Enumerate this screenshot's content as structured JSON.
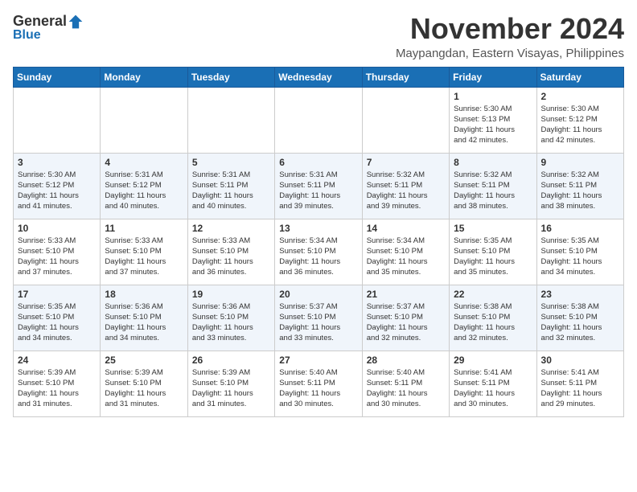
{
  "header": {
    "logo": {
      "general": "General",
      "blue": "Blue"
    },
    "title": "November 2024",
    "location": "Maypangdan, Eastern Visayas, Philippines"
  },
  "weekdays": [
    "Sunday",
    "Monday",
    "Tuesday",
    "Wednesday",
    "Thursday",
    "Friday",
    "Saturday"
  ],
  "weeks": [
    [
      {
        "day": "",
        "info": ""
      },
      {
        "day": "",
        "info": ""
      },
      {
        "day": "",
        "info": ""
      },
      {
        "day": "",
        "info": ""
      },
      {
        "day": "",
        "info": ""
      },
      {
        "day": "1",
        "info": "Sunrise: 5:30 AM\nSunset: 5:13 PM\nDaylight: 11 hours\nand 42 minutes."
      },
      {
        "day": "2",
        "info": "Sunrise: 5:30 AM\nSunset: 5:12 PM\nDaylight: 11 hours\nand 42 minutes."
      }
    ],
    [
      {
        "day": "3",
        "info": "Sunrise: 5:30 AM\nSunset: 5:12 PM\nDaylight: 11 hours\nand 41 minutes."
      },
      {
        "day": "4",
        "info": "Sunrise: 5:31 AM\nSunset: 5:12 PM\nDaylight: 11 hours\nand 40 minutes."
      },
      {
        "day": "5",
        "info": "Sunrise: 5:31 AM\nSunset: 5:11 PM\nDaylight: 11 hours\nand 40 minutes."
      },
      {
        "day": "6",
        "info": "Sunrise: 5:31 AM\nSunset: 5:11 PM\nDaylight: 11 hours\nand 39 minutes."
      },
      {
        "day": "7",
        "info": "Sunrise: 5:32 AM\nSunset: 5:11 PM\nDaylight: 11 hours\nand 39 minutes."
      },
      {
        "day": "8",
        "info": "Sunrise: 5:32 AM\nSunset: 5:11 PM\nDaylight: 11 hours\nand 38 minutes."
      },
      {
        "day": "9",
        "info": "Sunrise: 5:32 AM\nSunset: 5:11 PM\nDaylight: 11 hours\nand 38 minutes."
      }
    ],
    [
      {
        "day": "10",
        "info": "Sunrise: 5:33 AM\nSunset: 5:10 PM\nDaylight: 11 hours\nand 37 minutes."
      },
      {
        "day": "11",
        "info": "Sunrise: 5:33 AM\nSunset: 5:10 PM\nDaylight: 11 hours\nand 37 minutes."
      },
      {
        "day": "12",
        "info": "Sunrise: 5:33 AM\nSunset: 5:10 PM\nDaylight: 11 hours\nand 36 minutes."
      },
      {
        "day": "13",
        "info": "Sunrise: 5:34 AM\nSunset: 5:10 PM\nDaylight: 11 hours\nand 36 minutes."
      },
      {
        "day": "14",
        "info": "Sunrise: 5:34 AM\nSunset: 5:10 PM\nDaylight: 11 hours\nand 35 minutes."
      },
      {
        "day": "15",
        "info": "Sunrise: 5:35 AM\nSunset: 5:10 PM\nDaylight: 11 hours\nand 35 minutes."
      },
      {
        "day": "16",
        "info": "Sunrise: 5:35 AM\nSunset: 5:10 PM\nDaylight: 11 hours\nand 34 minutes."
      }
    ],
    [
      {
        "day": "17",
        "info": "Sunrise: 5:35 AM\nSunset: 5:10 PM\nDaylight: 11 hours\nand 34 minutes."
      },
      {
        "day": "18",
        "info": "Sunrise: 5:36 AM\nSunset: 5:10 PM\nDaylight: 11 hours\nand 34 minutes."
      },
      {
        "day": "19",
        "info": "Sunrise: 5:36 AM\nSunset: 5:10 PM\nDaylight: 11 hours\nand 33 minutes."
      },
      {
        "day": "20",
        "info": "Sunrise: 5:37 AM\nSunset: 5:10 PM\nDaylight: 11 hours\nand 33 minutes."
      },
      {
        "day": "21",
        "info": "Sunrise: 5:37 AM\nSunset: 5:10 PM\nDaylight: 11 hours\nand 32 minutes."
      },
      {
        "day": "22",
        "info": "Sunrise: 5:38 AM\nSunset: 5:10 PM\nDaylight: 11 hours\nand 32 minutes."
      },
      {
        "day": "23",
        "info": "Sunrise: 5:38 AM\nSunset: 5:10 PM\nDaylight: 11 hours\nand 32 minutes."
      }
    ],
    [
      {
        "day": "24",
        "info": "Sunrise: 5:39 AM\nSunset: 5:10 PM\nDaylight: 11 hours\nand 31 minutes."
      },
      {
        "day": "25",
        "info": "Sunrise: 5:39 AM\nSunset: 5:10 PM\nDaylight: 11 hours\nand 31 minutes."
      },
      {
        "day": "26",
        "info": "Sunrise: 5:39 AM\nSunset: 5:10 PM\nDaylight: 11 hours\nand 31 minutes."
      },
      {
        "day": "27",
        "info": "Sunrise: 5:40 AM\nSunset: 5:11 PM\nDaylight: 11 hours\nand 30 minutes."
      },
      {
        "day": "28",
        "info": "Sunrise: 5:40 AM\nSunset: 5:11 PM\nDaylight: 11 hours\nand 30 minutes."
      },
      {
        "day": "29",
        "info": "Sunrise: 5:41 AM\nSunset: 5:11 PM\nDaylight: 11 hours\nand 30 minutes."
      },
      {
        "day": "30",
        "info": "Sunrise: 5:41 AM\nSunset: 5:11 PM\nDaylight: 11 hours\nand 29 minutes."
      }
    ]
  ]
}
